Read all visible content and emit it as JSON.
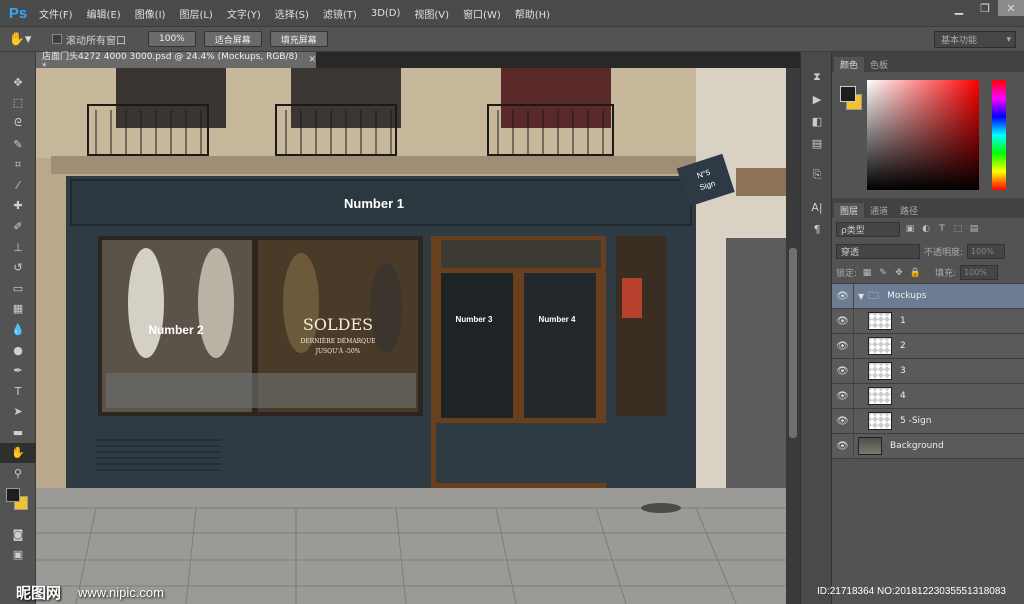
{
  "app": {
    "logo": "Ps"
  },
  "menu": [
    "文件(F)",
    "编辑(E)",
    "图像(I)",
    "图层(L)",
    "文字(Y)",
    "选择(S)",
    "滤镜(T)",
    "3D(D)",
    "视图(V)",
    "窗口(W)",
    "帮助(H)"
  ],
  "options": {
    "scroll_all_windows": "滚动所有窗口",
    "zoom_100": "100%",
    "fit_screen": "适合屏幕",
    "fill_screen": "填充屏幕",
    "workspace": "基本功能"
  },
  "document": {
    "tab_title": "店面门头4272 4000 3000.psd @ 24.4% (Mockups, RGB/8) *",
    "signs": {
      "sign1": "Number 1",
      "sign2": "Number 2",
      "sign3": "Number 3",
      "sign4": "Number 4",
      "sign5_line1": "N°5",
      "sign5_line2": "Sign",
      "soldes": "SOLDES",
      "soldes_sub1": "DERNIÈRE DÉMARQUE",
      "soldes_sub2": "JUSQU'À -50%"
    }
  },
  "color_panel": {
    "tabs": [
      "颜色",
      "色板"
    ],
    "fg_color": "#1e1e1e",
    "bg_color": "#f2c22a"
  },
  "layers_panel": {
    "tabs": [
      "图层",
      "通道",
      "路径"
    ],
    "filter_label": "ρ类型",
    "blend_mode": "穿透",
    "opacity_label": "不透明度:",
    "opacity_value": "100%",
    "lock_label": "锁定:",
    "fill_label": "填充:",
    "fill_value": "100%",
    "layers": [
      {
        "name": "Mockups",
        "type": "group",
        "selected": true
      },
      {
        "name": "1",
        "type": "smart"
      },
      {
        "name": "2",
        "type": "smart"
      },
      {
        "name": "3",
        "type": "smart"
      },
      {
        "name": "4",
        "type": "smart"
      },
      {
        "name": "5 -Sign",
        "type": "smart"
      },
      {
        "name": "Background",
        "type": "background"
      }
    ]
  },
  "watermark": {
    "left_cn": "昵图网",
    "left_url": "www.nipic.com",
    "right": "ID:21718364 NO:20181223035551318083"
  }
}
